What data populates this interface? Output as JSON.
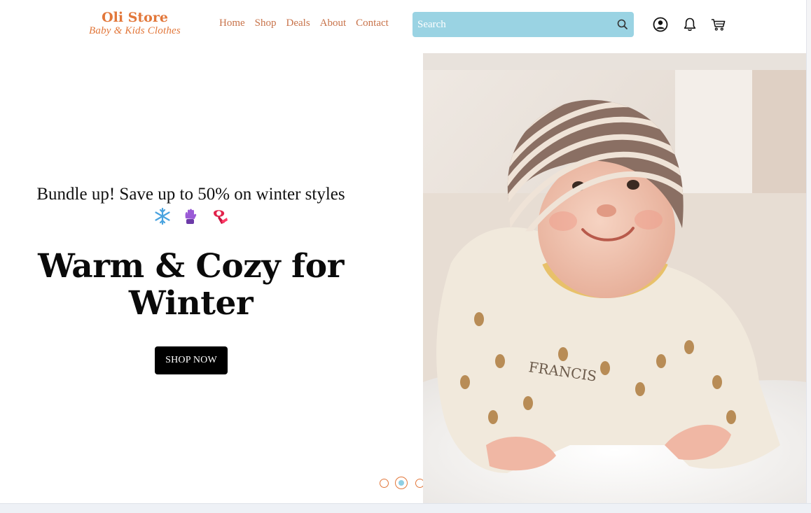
{
  "brand": {
    "name": "Oli Store",
    "tagline": "Baby & Kids Clothes",
    "accent_color": "#e2773a",
    "search_color": "#9ad3e3"
  },
  "nav": {
    "items": [
      {
        "label": "Home"
      },
      {
        "label": "Shop"
      },
      {
        "label": "Deals"
      },
      {
        "label": "About"
      },
      {
        "label": "Contact"
      }
    ]
  },
  "search": {
    "placeholder": "Search",
    "icon": "search-icon"
  },
  "header_icons": {
    "account": "user-circle-icon",
    "notifications": "bell-icon",
    "cart": "cart-icon"
  },
  "hero": {
    "promo_text": "Bundle up! Save up to 50% on winter styles",
    "emojis": [
      "snowflake-icon",
      "glove-icon",
      "scarf-icon"
    ],
    "headline_line1": "Warm & Cozy for",
    "headline_line2": "Winter",
    "cta_label": "SHOP NOW",
    "image": "baby-in-striped-beanie-photo",
    "carousel": {
      "slide_count": 3,
      "active_index": 1
    }
  }
}
